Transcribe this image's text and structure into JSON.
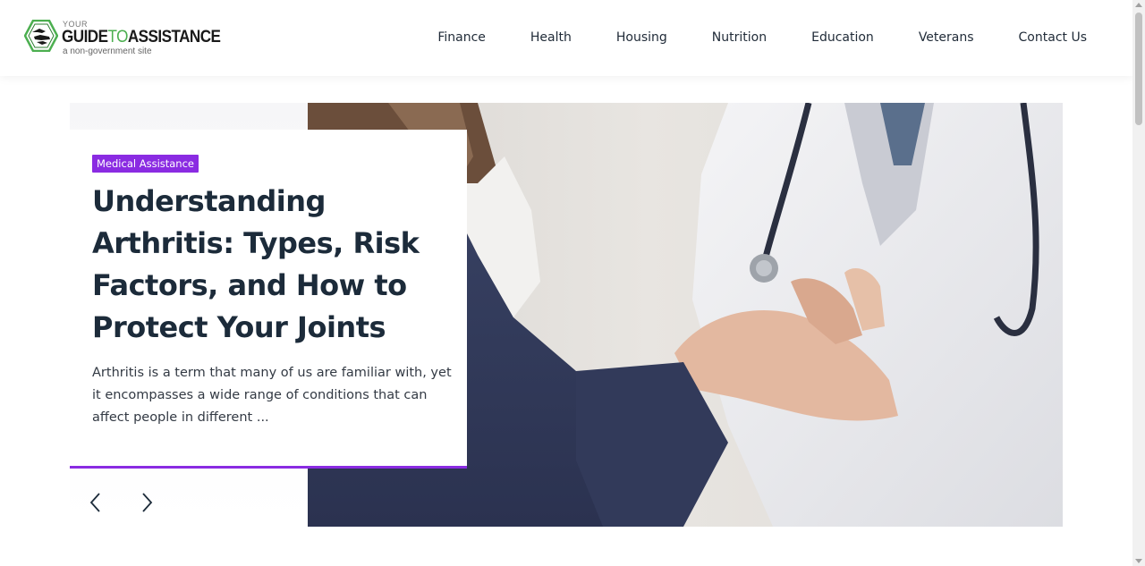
{
  "header": {
    "logo": {
      "your": "YOUR",
      "guide": "GUIDE",
      "to": "TO",
      "assistance": "ASSISTANCE",
      "tagline": "a non-government site"
    },
    "nav": [
      "Finance",
      "Health",
      "Housing",
      "Nutrition",
      "Education",
      "Veterans",
      "Contact Us"
    ]
  },
  "hero": {
    "category": "Medical Assistance",
    "title": "Understanding Arthritis: Types, Risk Factors, and How to Protect Your Joints",
    "excerpt": "Arthritis is a term that many of us are familiar with, yet it encompasses a wide range of conditions that can affect people in different ...",
    "image_alt": "Doctor examining a patient's wrist"
  },
  "controls": {
    "prev_icon": "chevron-left-icon",
    "next_icon": "chevron-right-icon"
  },
  "colors": {
    "accent": "#8a2be2",
    "heading": "#1c2b3a",
    "logo_green": "#4caf50",
    "text": "#1f2a37"
  }
}
